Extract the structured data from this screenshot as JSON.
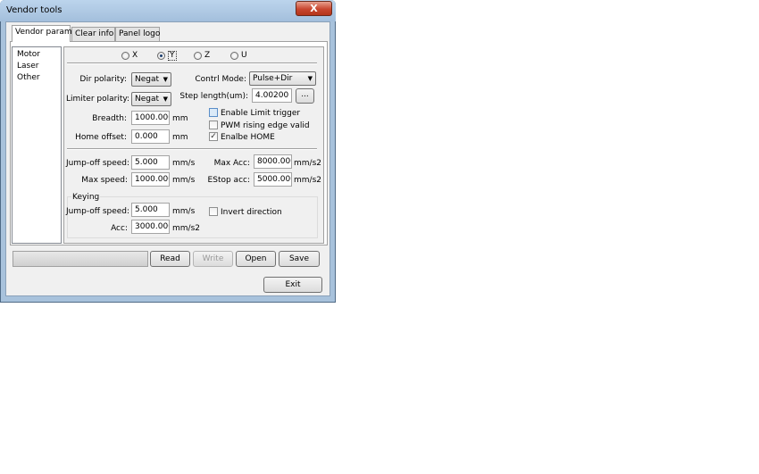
{
  "window": {
    "title": "Vendor tools",
    "close_label": "X"
  },
  "tabs": [
    "Vendor param",
    "Clear info",
    "Panel logo"
  ],
  "list_items": [
    "Motor",
    "Laser",
    "Other"
  ],
  "axes": {
    "options": [
      "X",
      "Y",
      "Z",
      "U"
    ],
    "selected": "Y"
  },
  "params": {
    "dir_polarity": {
      "label": "Dir polarity:",
      "value": "Negat"
    },
    "limiter_polarity": {
      "label": "Limiter polarity:",
      "value": "Negat"
    },
    "control_mode": {
      "label": "Contrl Mode:",
      "value": "Pulse+Dir"
    },
    "step_length": {
      "label": "Step length(um):",
      "value": "4.00200",
      "browse_label": "..."
    },
    "breadth": {
      "label": "Breadth:",
      "value": "1000.000",
      "unit": "mm"
    },
    "home_offset": {
      "label": "Home offset:",
      "value": "0.000",
      "unit": "mm"
    },
    "enable_limit_trigger": {
      "label": "Enable Limit trigger",
      "checked": false
    },
    "pwm_rising_edge": {
      "label": "PWM rising edge valid",
      "checked": false
    },
    "enable_home": {
      "label": "Enalbe HOME",
      "checked": true,
      "mark": "✓"
    }
  },
  "speeds": {
    "jump_off": {
      "label": "Jump-off speed:",
      "value": "5.000",
      "unit": "mm/s"
    },
    "max_speed": {
      "label": "Max speed:",
      "value": "1000.000",
      "unit": "mm/s"
    },
    "max_acc": {
      "label": "Max Acc:",
      "value": "8000.000",
      "unit": "mm/s2"
    },
    "estop_acc": {
      "label": "EStop acc:",
      "value": "5000.000",
      "unit": "mm/s2"
    }
  },
  "keying": {
    "title": "Keying",
    "jump_off": {
      "label": "Jump-off speed:",
      "value": "5.000",
      "unit": "mm/s"
    },
    "acc": {
      "label": "Acc:",
      "value": "3000.000",
      "unit": "mm/s2"
    },
    "invert_direction": {
      "label": "Invert direction",
      "checked": false
    }
  },
  "buttons": {
    "read": "Read",
    "write": "Write",
    "open": "Open",
    "save": "Save",
    "exit": "Exit"
  }
}
